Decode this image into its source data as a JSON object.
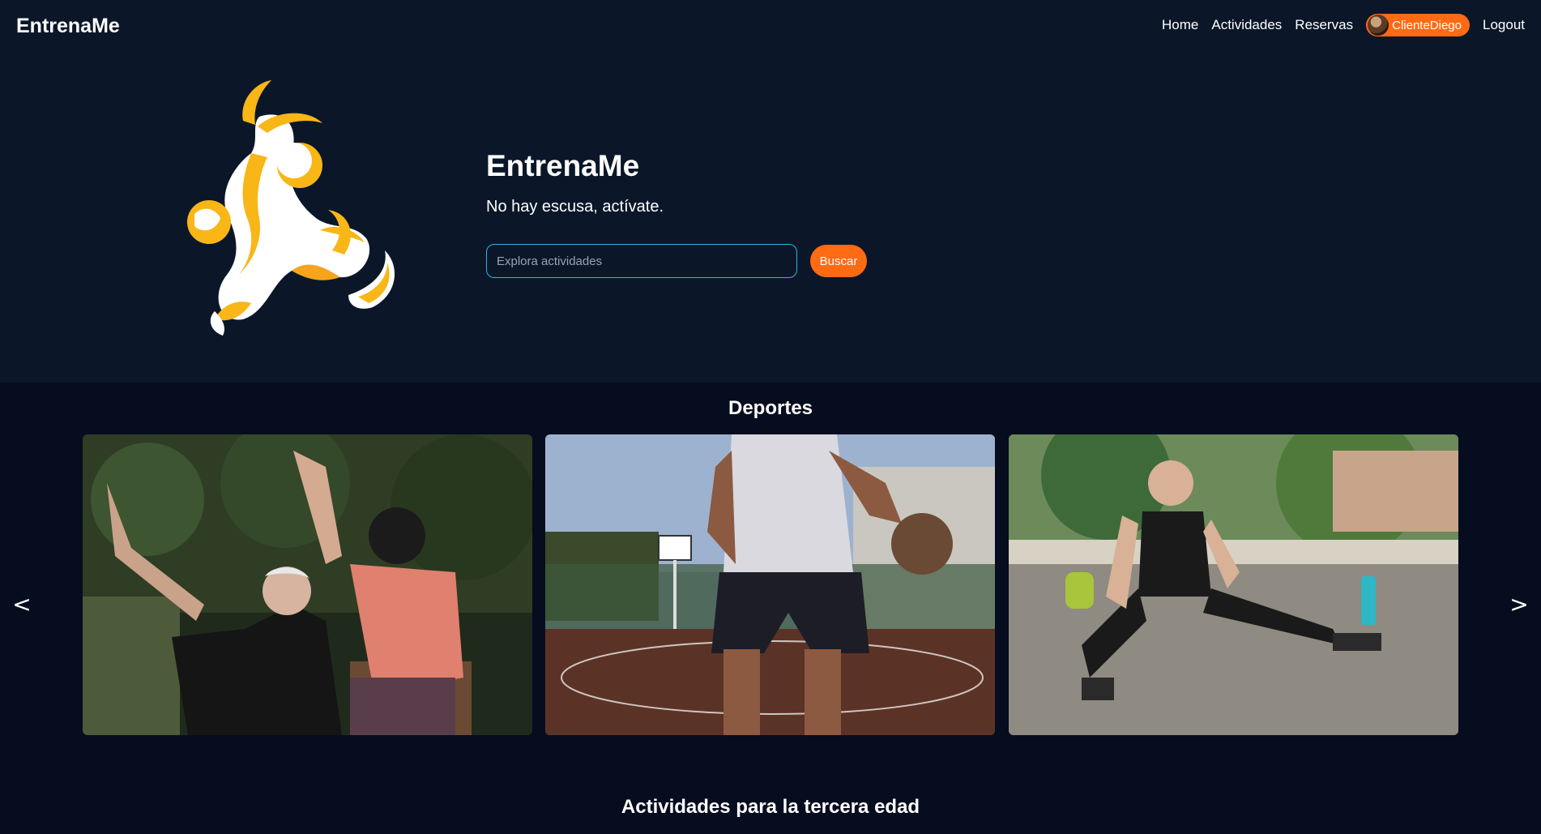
{
  "navbar": {
    "brand": "EntrenaMe",
    "links": [
      "Home",
      "Actividades",
      "Reservas"
    ],
    "user": "ClienteDiego",
    "logout": "Logout"
  },
  "hero": {
    "title": "EntrenaMe",
    "subtitle": "No hay escusa, actívate.",
    "search_placeholder": "Explora actividades",
    "search_button": "Buscar"
  },
  "sections": {
    "deportes": "Deportes",
    "tercera_edad": "Actividades para la tercera edad"
  },
  "carousel": {
    "prev": "<",
    "next": ">",
    "cards": [
      "stretching-seniors-photo",
      "basketball-player-photo",
      "fitness-woman-resting-photo"
    ]
  },
  "colors": {
    "accent": "#ff6a13",
    "navy": "#0b1729",
    "background": "#050d1e",
    "input_border": "#2fb4dd"
  }
}
